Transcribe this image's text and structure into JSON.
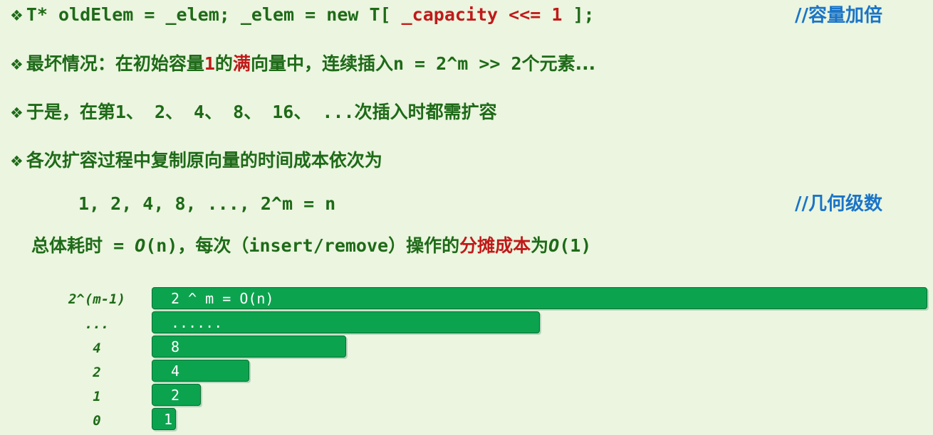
{
  "lines": {
    "code": {
      "bullet": "❖",
      "part1": "T* oldElem = _elem; _elem = new T[ ",
      "highlight": "_capacity <<= 1",
      "part2": " ];"
    },
    "code_comment": "//容量加倍",
    "worst": {
      "bullet": "❖",
      "part1": "最坏情况：在初始容量",
      "one": "1",
      "part2": "的",
      "full": "满",
      "part3": "向量中，连续插入",
      "expr": "n = 2^m >> 2",
      "part4": "个元素..."
    },
    "then": {
      "bullet": "❖",
      "part1": "于是，在第",
      "seq": "1、 2、 4、 8、 16、 ...",
      "part2": "次插入时都需扩容"
    },
    "costs": {
      "bullet": "❖",
      "text": "各次扩容过程中复制原向量的时间成本依次为"
    },
    "series": "1, 2, 4, 8, ..., 2^m = n",
    "series_comment": "//几何级数",
    "total": {
      "part1": "总体耗时",
      "eq": " = ",
      "o1": "O",
      "n": "(n)",
      "part2": "，每次（",
      "ops": "insert/remove",
      "part3": "）操作的",
      "amortized": "分摊成本",
      "part4": "为",
      "o2": "O",
      "one": "(1)"
    }
  },
  "bars": [
    {
      "label": "2^(m-1)",
      "text": "2 ^ m = O(n)"
    },
    {
      "label": "...",
      "text": "......"
    },
    {
      "label": "4",
      "text": "8"
    },
    {
      "label": "2",
      "text": "4"
    },
    {
      "label": "1",
      "text": "2"
    },
    {
      "label": "0",
      "text": "1"
    }
  ],
  "colors": {
    "background": "#ebf5df",
    "text_green": "#1e6a18",
    "highlight_red": "#c01a1a",
    "comment_blue": "#1a74c8",
    "bar_green": "#0ca34f"
  }
}
